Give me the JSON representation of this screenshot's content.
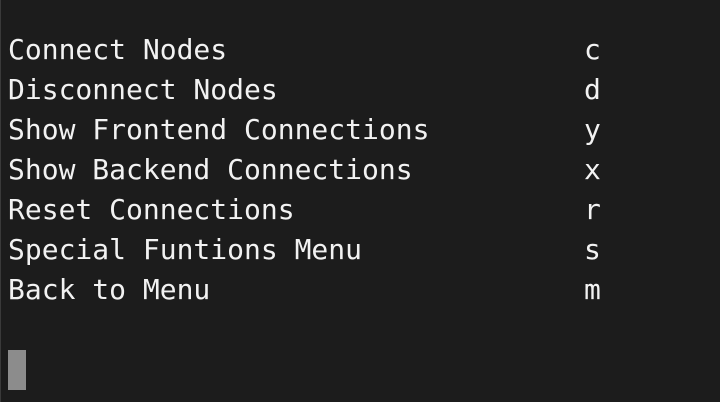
{
  "menu": {
    "items": [
      {
        "label": "Connect Nodes",
        "key": "c"
      },
      {
        "label": "Disconnect Nodes",
        "key": "d"
      },
      {
        "label": "Show Frontend Connections",
        "key": "y"
      },
      {
        "label": "Show Backend Connections",
        "key": "x"
      },
      {
        "label": "Reset Connections",
        "key": "r"
      },
      {
        "label": "Special Funtions Menu",
        "key": "s"
      },
      {
        "label": "Back to Menu",
        "key": "m"
      }
    ]
  }
}
